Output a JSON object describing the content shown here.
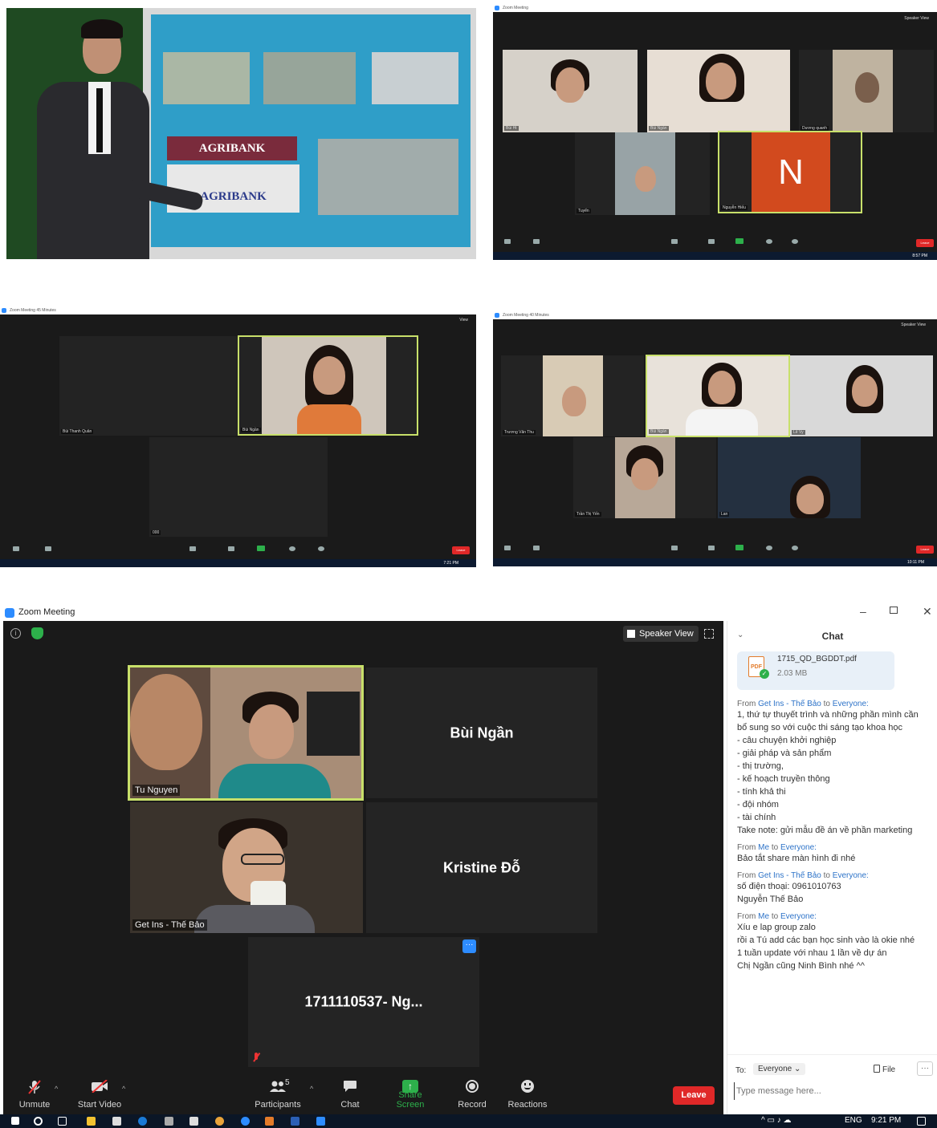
{
  "presentation": {
    "slide_title_1": "AGRIBANK",
    "slide_title_2": "AGRIBANK"
  },
  "shot2": {
    "window_title": "Zoom Meeting",
    "speaker_view": "Speaker View",
    "participants": [
      "Bùi Ht",
      "Bùi Ngần",
      "Dương quanh",
      "Tuyển",
      "Nguyễn Hiếu"
    ],
    "avatar_letter": "N",
    "toolbar": [
      "Mute",
      "Stop Video",
      "Participants",
      "Chat",
      "Share Screen",
      "Record",
      "Reactions"
    ],
    "leave": "Leave",
    "clock": "8:57 PM",
    "lang": "ENG"
  },
  "shot3": {
    "window_title": "Zoom Meeting 45 Minutes",
    "view": "View",
    "participants": [
      "Bùi Thanh Quân",
      "Bùi Ngần",
      "000"
    ],
    "toolbar": [
      "Mute",
      "Stop Video",
      "Participants",
      "Chat",
      "Share Screen",
      "Record",
      "Reactions"
    ],
    "leave": "Leave",
    "clock": "7:21 PM",
    "lang": "ENG"
  },
  "shot4": {
    "window_title": "Zoom Meeting 40 Minutes",
    "speaker_view": "Speaker View",
    "participants": [
      "Trương Văn Thu",
      "Bùi Ngần",
      "Lê Vy",
      "Trần Thị Yến",
      "Lan"
    ],
    "toolbar": [
      "Mute",
      "Stop Video",
      "Participants",
      "Chat",
      "Share Screen",
      "Record",
      "Reactions"
    ],
    "leave": "Leave",
    "clock": "10:11 PM",
    "lang": "ENG"
  },
  "zoom": {
    "window_title": "Zoom Meeting",
    "speaker_view": "Speaker View",
    "videos": {
      "tu_nguyen": "Tu Nguyen",
      "bui_ngan": "Bùi Ngần",
      "get_ins": "Get Ins - Thế Bảo",
      "kristine": "Kristine Đỗ",
      "phone_user": "1711110537- Ng..."
    },
    "toolbar": {
      "unmute": "Unmute",
      "start_video": "Start Video",
      "participants": "Participants",
      "participants_count": "5",
      "chat": "Chat",
      "share_screen": "Share Screen",
      "record": "Record",
      "reactions": "Reactions",
      "leave": "Leave"
    },
    "chat": {
      "title": "Chat",
      "file_name": "1715_QD_BGDDT.pdf",
      "file_size": "2.03 MB",
      "file_badge": "PDF",
      "messages": [
        {
          "from_word": "From",
          "sender": "Get Ins - Thế Bảo",
          "to_word": "to",
          "recipient": "Everyone:",
          "lines": [
            "1, thứ tự thuyết trình và những phần mình cần bổ sung so với cuộc thi sáng tạo khoa học",
            "- câu chuyện khởi nghiệp",
            "- giải pháp và sản phẩm",
            "- thị trường,",
            "- kế hoạch truyền thông",
            "- tính khả thi",
            "- đội nhóm",
            "- tài chính",
            "Take note: gửi mẫu đề án về phần marketing"
          ]
        },
        {
          "from_word": "From",
          "sender": "Me",
          "to_word": "to",
          "recipient": "Everyone:",
          "lines": [
            "Bảo tắt share màn hình đi nhé"
          ]
        },
        {
          "from_word": "From",
          "sender": "Get Ins - Thế Bảo",
          "to_word": "to",
          "recipient": "Everyone:",
          "lines": [
            "số điện thoại: 0961010763",
            "Nguyễn Thế Bảo"
          ]
        },
        {
          "from_word": "From",
          "sender": "Me",
          "to_word": "to",
          "recipient": "Everyone:",
          "lines": [
            "Xíu e lap group zalo",
            "rồi a Tú add các bạn học sinh vào là okie nhé",
            "1 tuần update với nhau 1 lần về dự án",
            "Chị Ngần cũng Ninh Bình nhé ^^"
          ]
        }
      ],
      "to_label": "To:",
      "to_value": "Everyone",
      "file_button": "File",
      "more": "···",
      "input_placeholder": "Type message here..."
    },
    "taskbar": {
      "lang": "ENG",
      "clock": "9:21 PM"
    }
  },
  "colors": {
    "zoom_blue": "#2d8cff",
    "active_speaker": "#c8e06a",
    "leave_red": "#e02828",
    "share_green": "#2db04b",
    "chat_link": "#2d73c8"
  }
}
